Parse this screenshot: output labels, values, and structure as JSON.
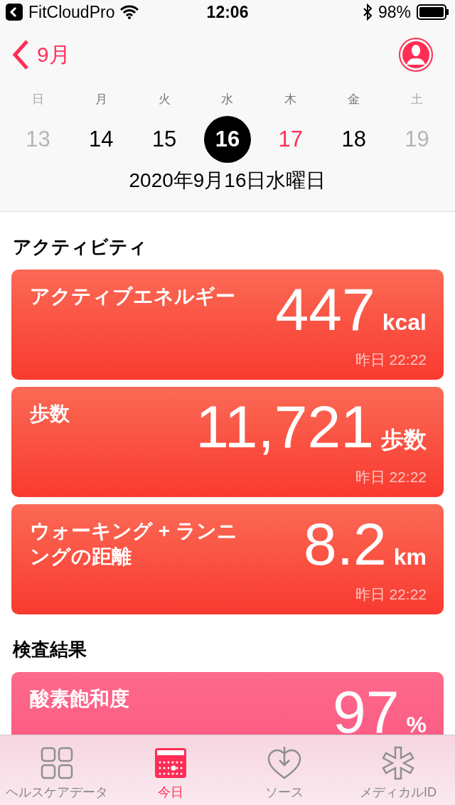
{
  "status_bar": {
    "back_app": "FitCloudPro",
    "time": "12:06",
    "battery": "98%"
  },
  "nav": {
    "back_label": "9月"
  },
  "week": {
    "weekdays": [
      "日",
      "月",
      "火",
      "水",
      "木",
      "金",
      "土"
    ],
    "days": [
      {
        "label": "13",
        "kind": "weekend",
        "selected": false,
        "today": false
      },
      {
        "label": "14",
        "kind": "weekday",
        "selected": false,
        "today": false
      },
      {
        "label": "15",
        "kind": "weekday",
        "selected": false,
        "today": false
      },
      {
        "label": "16",
        "kind": "weekday",
        "selected": true,
        "today": false
      },
      {
        "label": "17",
        "kind": "weekday",
        "selected": false,
        "today": true
      },
      {
        "label": "18",
        "kind": "weekday",
        "selected": false,
        "today": false
      },
      {
        "label": "19",
        "kind": "weekend",
        "selected": false,
        "today": false
      }
    ],
    "date_label": "2020年9月16日水曜日"
  },
  "sections": [
    {
      "title": "アクティビティ",
      "cards": [
        {
          "kind": "activity",
          "title": "アクティブエネルギー",
          "value": "447",
          "unit": "kcal",
          "time": "昨日 22:22"
        },
        {
          "kind": "activity",
          "title": "歩数",
          "value": "11,721",
          "unit": "歩数",
          "time": "昨日 22:22"
        },
        {
          "kind": "activity",
          "title": "ウォーキング + ランニングの距離",
          "value": "8.2",
          "unit": "km",
          "time": "昨日 22:22"
        }
      ]
    },
    {
      "title": "検査結果",
      "cards": [
        {
          "kind": "lab",
          "title": "酸素飽和度",
          "value": "97",
          "unit": "%"
        }
      ]
    }
  ],
  "tab_bar": [
    {
      "label": "ヘルスケアデータ",
      "kind": "grid",
      "selected": false
    },
    {
      "label": "今日",
      "kind": "calendar",
      "selected": true
    },
    {
      "label": "ソース",
      "kind": "heart",
      "selected": false
    },
    {
      "label": "メディカルID",
      "kind": "asterisk",
      "selected": false
    }
  ]
}
